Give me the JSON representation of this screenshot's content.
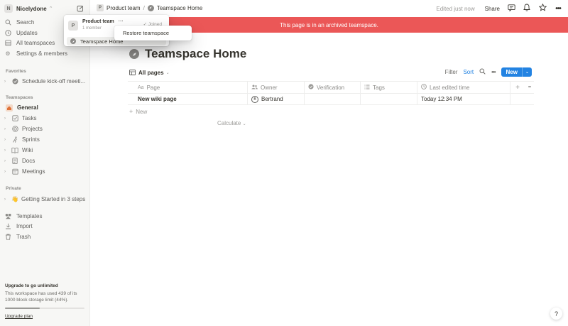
{
  "workspace": {
    "initial": "N",
    "name": "Nicelydone"
  },
  "sidebar": {
    "top_items": [
      {
        "label": "Search",
        "icon": "search-icon"
      },
      {
        "label": "Updates",
        "icon": "updates-icon"
      },
      {
        "label": "All teamspaces",
        "icon": "teamspaces-icon"
      },
      {
        "label": "Settings & members",
        "icon": "gear-icon"
      }
    ],
    "favorites_heading": "Favorites",
    "favorites": [
      {
        "label": "Schedule kick-off meeti..."
      }
    ],
    "teamspaces_heading": "Teamspaces",
    "teamspaces": [
      {
        "label": "General"
      },
      {
        "label": "Tasks"
      },
      {
        "label": "Projects"
      },
      {
        "label": "Sprints"
      },
      {
        "label": "Wiki"
      },
      {
        "label": "Docs"
      },
      {
        "label": "Meetings"
      }
    ],
    "private_heading": "Private",
    "private": [
      {
        "label": "Getting Started in 3 steps",
        "emoji": "👋"
      }
    ],
    "bottom_items": [
      {
        "label": "Templates"
      },
      {
        "label": "Import"
      },
      {
        "label": "Trash"
      }
    ],
    "upgrade": {
      "title": "Upgrade to go unlimited",
      "text": "This workspace has used 439 of its 1000 block storage limit (44%).",
      "usage_fraction": 0.44,
      "link": "Upgrade plan"
    }
  },
  "topbar": {
    "crumb_team_initial": "P",
    "crumb_team": "Product team",
    "crumb_sep": "/",
    "crumb_page": "Teamspace Home",
    "edited": "Edited just now",
    "share": "Share"
  },
  "banner": {
    "text": "This page is in an archived teamspace."
  },
  "page": {
    "title": "Teamspace Home"
  },
  "view": {
    "tab": "All pages",
    "filter": "Filter",
    "sort": "Sort",
    "new_label": "New"
  },
  "table": {
    "headers": {
      "page": "Page",
      "page_prefix": "Aa",
      "owner": "Owner",
      "verification": "Verification",
      "tags": "Tags",
      "last_edited": "Last edited time"
    },
    "rows": [
      {
        "page": "New wiki page",
        "owner_initial": "B",
        "owner": "Bertrand",
        "verification": "",
        "tags": "",
        "last_edited": "Today 12:34 PM"
      }
    ],
    "add_new": "New",
    "calculate": "Calculate"
  },
  "team_popup": {
    "initial": "P",
    "name": "Product team",
    "members": "1 member",
    "joined": "Joined",
    "item": "Teamspace Home"
  },
  "restore_popup": {
    "label": "Restore teamspace"
  },
  "help": {
    "label": "?"
  },
  "colors": {
    "banner": "#eb5757",
    "accent": "#2383e2",
    "sidebar_bg": "#f7f7f5"
  }
}
